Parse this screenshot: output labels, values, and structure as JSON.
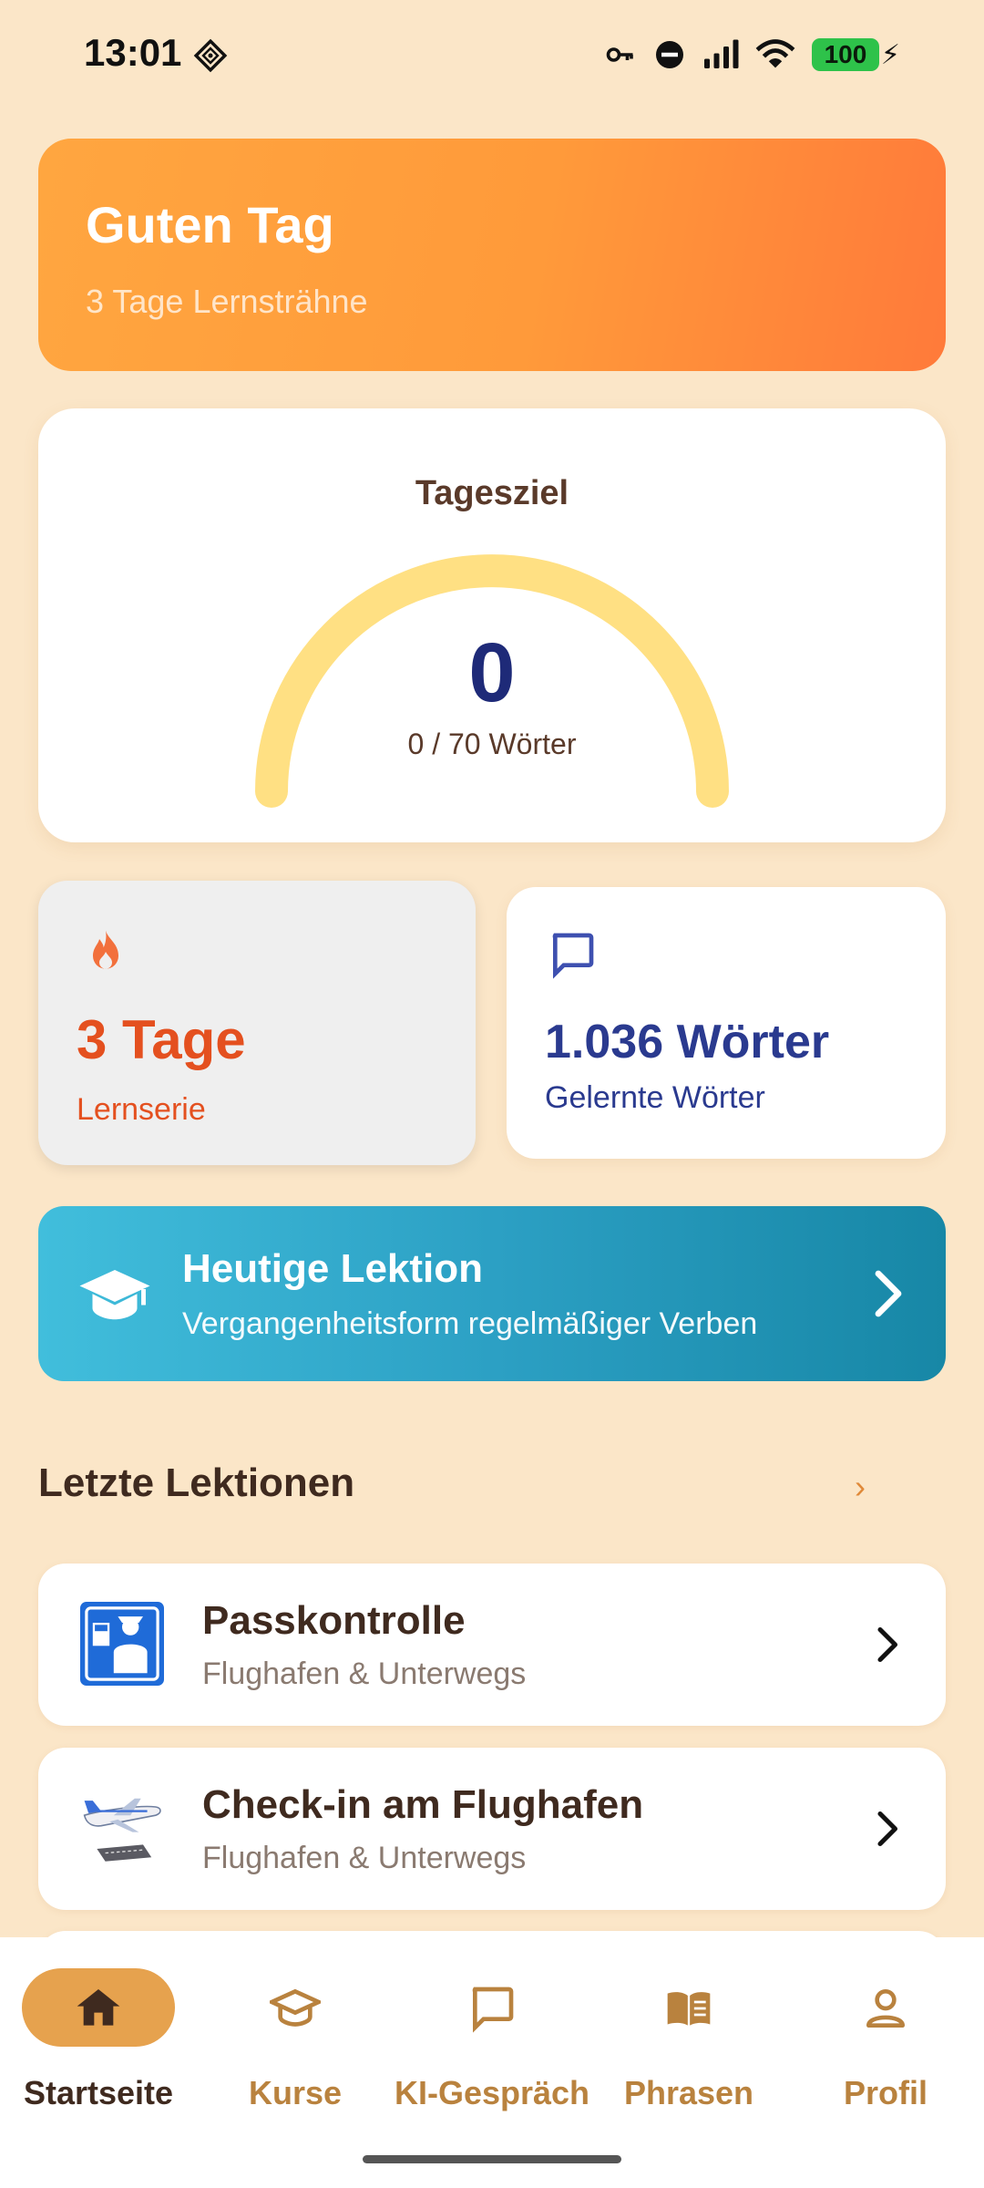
{
  "status_bar": {
    "time": "13:01",
    "battery": "100",
    "icons": [
      "vpn-key-icon",
      "do-not-disturb-icon",
      "signal-icon",
      "wifi-icon",
      "battery-icon"
    ]
  },
  "greeting": {
    "title": "Guten Tag",
    "subtitle": "3 Tage Lernsträhne"
  },
  "daily_goal": {
    "title": "Tagesziel",
    "value": "0",
    "caption": "0 / 70 Wörter",
    "progress_fraction": 0,
    "track_color": "#FFE083"
  },
  "stats": {
    "streak": {
      "value": "3 Tage",
      "label": "Lernserie",
      "icon": "flame-icon",
      "color": "#E4501F"
    },
    "words": {
      "value": "1.036 Wörter",
      "label": "Gelernte Wörter",
      "icon": "chat-bubble-icon",
      "color": "#2a3a8f"
    }
  },
  "today_lesson": {
    "title": "Heutige Lektion",
    "subtitle": "Vergangenheitsform regelmäßiger Verben",
    "icon": "graduation-cap-icon"
  },
  "recent": {
    "title": "Letzte Lektionen",
    "more": "›",
    "items": [
      {
        "title": "Passkontrolle",
        "subtitle": "Flughafen & Unterwegs",
        "icon": "passport-control-icon"
      },
      {
        "title": "Check-in am Flughafen",
        "subtitle": "Flughafen & Unterwegs",
        "icon": "airplane-icon"
      }
    ]
  },
  "nav": {
    "items": [
      {
        "label": "Startseite",
        "icon": "home-icon",
        "active": true
      },
      {
        "label": "Kurse",
        "icon": "graduation-cap-icon",
        "active": false
      },
      {
        "label": "KI-Gespräch",
        "icon": "chat-bubble-icon",
        "active": false
      },
      {
        "label": "Phrasen",
        "icon": "book-icon",
        "active": false
      },
      {
        "label": "Profil",
        "icon": "person-icon",
        "active": false
      }
    ]
  },
  "colors": {
    "background": "#FBE6C8",
    "accent": "#E6A24E",
    "banner_start": "#41BEDC",
    "banner_end": "#1787A6"
  }
}
